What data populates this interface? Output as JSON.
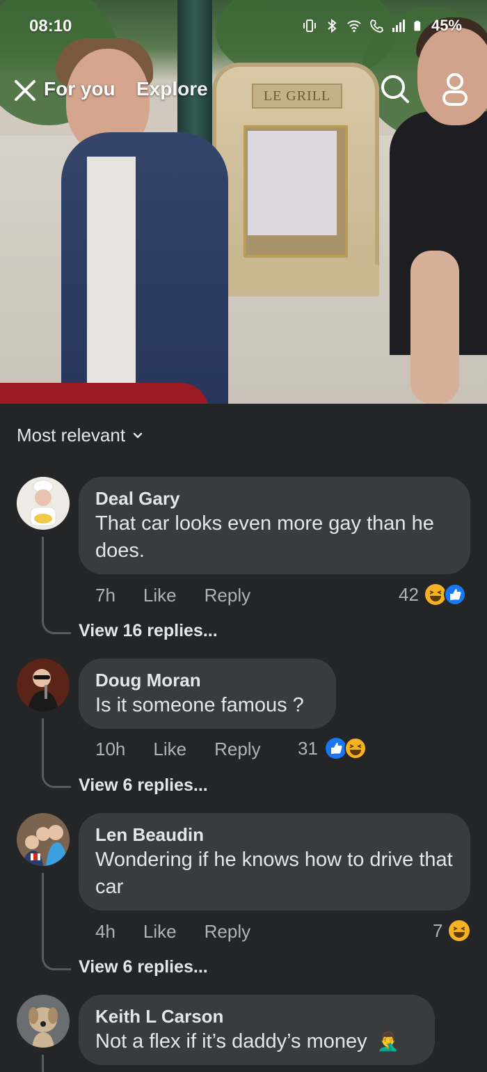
{
  "status_bar": {
    "time": "08:10",
    "battery": "45%",
    "icons": [
      "vibrate-icon",
      "bluetooth-icon",
      "wifi-icon",
      "call-icon",
      "signal-icon",
      "battery-icon"
    ]
  },
  "top_nav": {
    "tabs": [
      {
        "label": "For you",
        "active": true
      },
      {
        "label": "Explore",
        "active": false
      }
    ],
    "icons": [
      "close-icon",
      "search-icon",
      "profile-icon"
    ]
  },
  "media": {
    "sign_text": "LE GRILL"
  },
  "comments_sheet": {
    "sort_label": "Most relevant",
    "comments": [
      {
        "author": "Deal Gary",
        "text": "That car looks even more gay than he does.",
        "time": "7h",
        "like_label": "Like",
        "reply_label": "Reply",
        "reaction_count": "42",
        "reactions": [
          "haha-icon",
          "like-icon"
        ],
        "view_replies": "View 16 replies..."
      },
      {
        "author": "Doug Moran",
        "text": "Is it someone famous ?",
        "time": "10h",
        "like_label": "Like",
        "reply_label": "Reply",
        "reaction_count": "31",
        "reactions": [
          "like-icon",
          "haha-icon"
        ],
        "view_replies": "View 6 replies..."
      },
      {
        "author": "Len Beaudin",
        "text": "Wondering if he knows how to drive that car",
        "time": "4h",
        "like_label": "Like",
        "reply_label": "Reply",
        "reaction_count": "7",
        "reactions": [
          "haha-icon"
        ],
        "view_replies": "View 6 replies..."
      },
      {
        "author": "Keith L Carson",
        "text": "Not a flex if it’s daddy’s money",
        "emoji": "🤦‍♂️"
      }
    ]
  },
  "colors": {
    "sheet_bg": "#242526",
    "bubble_bg": "#3a3b3c",
    "text_primary": "#e4e6eb",
    "text_secondary": "#b0b3b8",
    "like_blue": "#1877f2",
    "haha_yellow": "#f7b125"
  }
}
